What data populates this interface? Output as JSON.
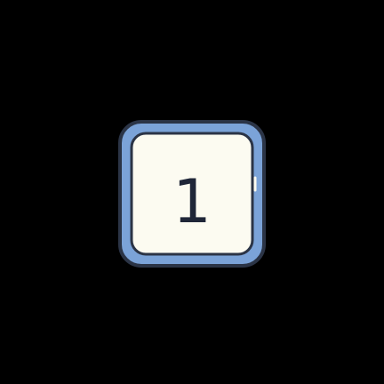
{
  "icon": {
    "name": "number-one-icon",
    "glyph": "1",
    "colors": {
      "background": "#000000",
      "frame": "#7BA3D8",
      "outline": "#2B3446",
      "inner_fill": "#FCFBF1",
      "glyph": "#1F2638"
    }
  }
}
